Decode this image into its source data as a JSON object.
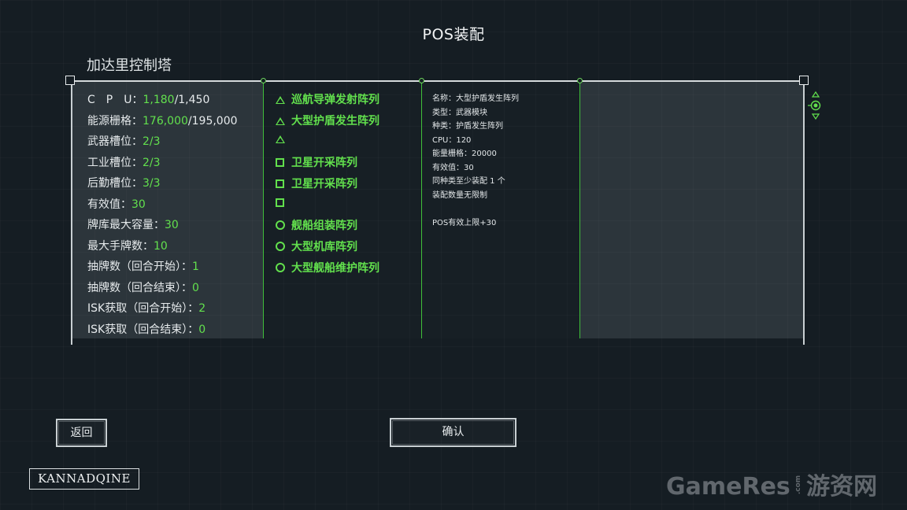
{
  "screen_title": "POS装配",
  "tower_name": "加达里控制塔",
  "stats": [
    {
      "label": "C　P　U：",
      "value": "1,180",
      "max": "/1,450"
    },
    {
      "label": "能源栅格：",
      "value": "176,000",
      "max": "/195,000"
    },
    {
      "label": "武器槽位：",
      "value": "2/3",
      "max": ""
    },
    {
      "label": "工业槽位：",
      "value": "2/3",
      "max": ""
    },
    {
      "label": "后勤槽位：",
      "value": "3/3",
      "max": ""
    },
    {
      "label": "有效值：",
      "value": "30",
      "max": ""
    },
    {
      "label": "牌库最大容量：",
      "value": "30",
      "max": ""
    },
    {
      "label": "最大手牌数：",
      "value": "10",
      "max": ""
    },
    {
      "label": "抽牌数（回合开始）：",
      "value": "1",
      "max": ""
    },
    {
      "label": "抽牌数（回合结束）：",
      "value": "0",
      "max": ""
    },
    {
      "label": "ISK获取（回合开始）：",
      "value": "2",
      "max": ""
    },
    {
      "label": "ISK获取（回合结束）：",
      "value": "0",
      "max": ""
    }
  ],
  "modules": [
    {
      "shape": "triangle",
      "label": "巡航导弹发射阵列"
    },
    {
      "shape": "triangle",
      "label": "大型护盾发生阵列"
    },
    {
      "shape": "triangle",
      "label": ""
    },
    {
      "shape": "square",
      "label": "卫星开采阵列"
    },
    {
      "shape": "square",
      "label": "卫星开采阵列"
    },
    {
      "shape": "square",
      "label": ""
    },
    {
      "shape": "circle",
      "label": "舰船组装阵列"
    },
    {
      "shape": "circle",
      "label": "大型机库阵列"
    },
    {
      "shape": "circle",
      "label": "大型舰船维护阵列"
    }
  ],
  "details": [
    "名称：大型护盾发生阵列",
    "类型：武器模块",
    "种类：护盾发生阵列",
    "CPU：120",
    "能量栅格：20000",
    "有效值：30",
    "同种类至少装配 1 个",
    "装配数量无限制",
    "",
    "POS有效上限+30"
  ],
  "buttons": {
    "back": "返回",
    "confirm": "确认"
  },
  "logo": "KANNADQINE",
  "watermark": {
    "brand": "GameRes",
    "com": ".com",
    "cn": "游资网"
  },
  "colors": {
    "accent": "#62e04d",
    "line": "#3fbf3a",
    "background": "#151d23"
  }
}
